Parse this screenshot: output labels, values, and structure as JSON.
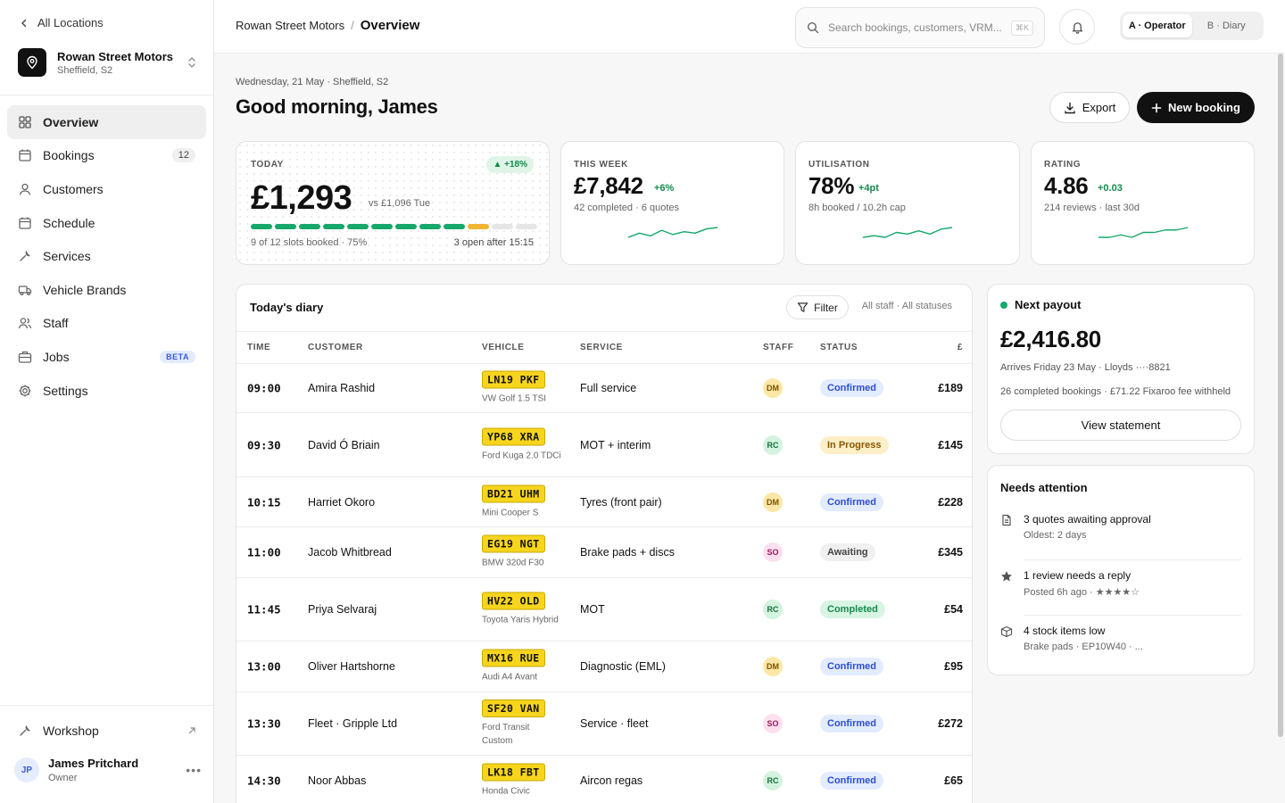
{
  "sidebar": {
    "back_label": "All Locations",
    "location": {
      "name": "Rowan Street Motors",
      "area": "Sheffield, S2"
    },
    "items": [
      {
        "label": "Overview",
        "badge": ""
      },
      {
        "label": "Bookings",
        "badge": "12"
      },
      {
        "label": "Customers",
        "badge": ""
      },
      {
        "label": "Schedule",
        "badge": ""
      },
      {
        "label": "Services",
        "badge": ""
      },
      {
        "label": "Vehicle Brands",
        "badge": ""
      },
      {
        "label": "Staff",
        "badge": ""
      },
      {
        "label": "Jobs",
        "badge": "BETA"
      },
      {
        "label": "Settings",
        "badge": ""
      }
    ],
    "workshop_label": "Workshop",
    "user": {
      "initials": "JP",
      "name": "James Pritchard",
      "role": "Owner"
    }
  },
  "header": {
    "crumb_parent": "Rowan Street Motors",
    "crumb_sep": "/",
    "crumb_current": "Overview",
    "search_placeholder": "Search bookings, customers, VRM...",
    "search_shortcut": "⌘K",
    "view_toggle": [
      "A · Operator",
      "B · Diary"
    ]
  },
  "page": {
    "date_line": "Wednesday, 21 May · Sheffield, S2",
    "greeting": "Good morning, James",
    "export_label": "Export",
    "new_booking_label": "New booking"
  },
  "kpis": {
    "today": {
      "label": "TODAY",
      "badge": "▲ +18%",
      "value": "£1,293",
      "compare": "vs £1,096 Tue",
      "slots_booked": 9,
      "slots_total": 12,
      "footer_left": "9 of 12 slots booked · 75%",
      "footer_right": "3 open after 15:15"
    },
    "week": {
      "label": "THIS WEEK",
      "value": "£7,842",
      "delta": "+6%",
      "sub": "42 completed · 6 quotes",
      "spark": [
        3,
        6,
        4,
        8,
        5,
        7,
        6,
        9,
        10
      ]
    },
    "utilisation": {
      "label": "UTILISATION",
      "value": "78%",
      "delta": "+4pt",
      "sub": "8h booked / 10.2h cap",
      "spark": [
        3,
        4,
        3,
        6,
        5,
        7,
        5,
        8,
        9
      ]
    },
    "rating": {
      "label": "RATING",
      "value": "4.86",
      "delta": "+0.03",
      "sub": "214 reviews · last 30d",
      "spark": [
        5,
        5,
        5.1,
        5,
        5.2,
        5.2,
        5.3,
        5.3,
        5.4
      ]
    }
  },
  "diary": {
    "title": "Today's diary",
    "filter_label": "Filter",
    "filter_meta": "All staff · All statuses",
    "columns": [
      "TIME",
      "CUSTOMER",
      "VEHICLE",
      "SERVICE",
      "STAFF",
      "STATUS",
      "£"
    ],
    "rows": [
      {
        "time": "09:00",
        "customer": "Amira Rashid",
        "plate": "LN19 PKF",
        "model": "VW Golf 1.5 TSI",
        "service": "Full service",
        "staff": "DM",
        "status": "Confirmed",
        "amount": "£189"
      },
      {
        "time": "09:30",
        "customer": "David Ó Briain",
        "plate": "YP68 XRA",
        "model": "Ford Kuga 2.0 TDCi",
        "service": "MOT + interim",
        "staff": "RC",
        "status": "In Progress",
        "amount": "£145"
      },
      {
        "time": "10:15",
        "customer": "Harriet Okoro",
        "plate": "BD21 UHM",
        "model": "Mini Cooper S",
        "service": "Tyres (front pair)",
        "staff": "DM",
        "status": "Confirmed",
        "amount": "£228"
      },
      {
        "time": "11:00",
        "customer": "Jacob Whitbread",
        "plate": "EG19 NGT",
        "model": "BMW 320d F30",
        "service": "Brake pads + discs",
        "staff": "SO",
        "status": "Awaiting",
        "amount": "£345"
      },
      {
        "time": "11:45",
        "customer": "Priya Selvaraj",
        "plate": "HV22 OLD",
        "model": "Toyota Yaris Hybrid",
        "service": "MOT",
        "staff": "RC",
        "status": "Completed",
        "amount": "£54"
      },
      {
        "time": "13:00",
        "customer": "Oliver Hartshorne",
        "plate": "MX16 RUE",
        "model": "Audi A4 Avant",
        "service": "Diagnostic (EML)",
        "staff": "DM",
        "status": "Confirmed",
        "amount": "£95"
      },
      {
        "time": "13:30",
        "customer": "Fleet · Gripple Ltd",
        "plate": "SF20 VAN",
        "model": "Ford Transit Custom",
        "service": "Service · fleet",
        "staff": "SO",
        "status": "Confirmed",
        "amount": "£272"
      },
      {
        "time": "14:30",
        "customer": "Noor Abbas",
        "plate": "LK18 FBT",
        "model": "Honda Civic",
        "service": "Aircon regas",
        "staff": "RC",
        "status": "Confirmed",
        "amount": "£65"
      }
    ]
  },
  "payout": {
    "title": "Next payout",
    "amount": "£2,416.80",
    "arrives": "Arrives Friday 23 May · Lloyds ····8821",
    "note": "26 completed bookings · £71.22 Fixaroo fee withheld",
    "button": "View statement"
  },
  "attention": {
    "title": "Needs attention",
    "items": [
      {
        "icon": "document-icon",
        "title": "3 quotes awaiting approval",
        "sub": "Oldest: 2 days"
      },
      {
        "icon": "star-icon",
        "title": "1 review needs a reply",
        "sub": "Posted 6h ago · ★★★★☆"
      },
      {
        "icon": "box-icon",
        "title": "4 stock items low",
        "sub": "Brake pads · EP10W40 · ..."
      }
    ]
  },
  "colors": {
    "accent_green": "#16a86b",
    "partial_amber": "#f2b531",
    "plate_yellow": "#f7d51d",
    "primary_dark": "#111111"
  }
}
